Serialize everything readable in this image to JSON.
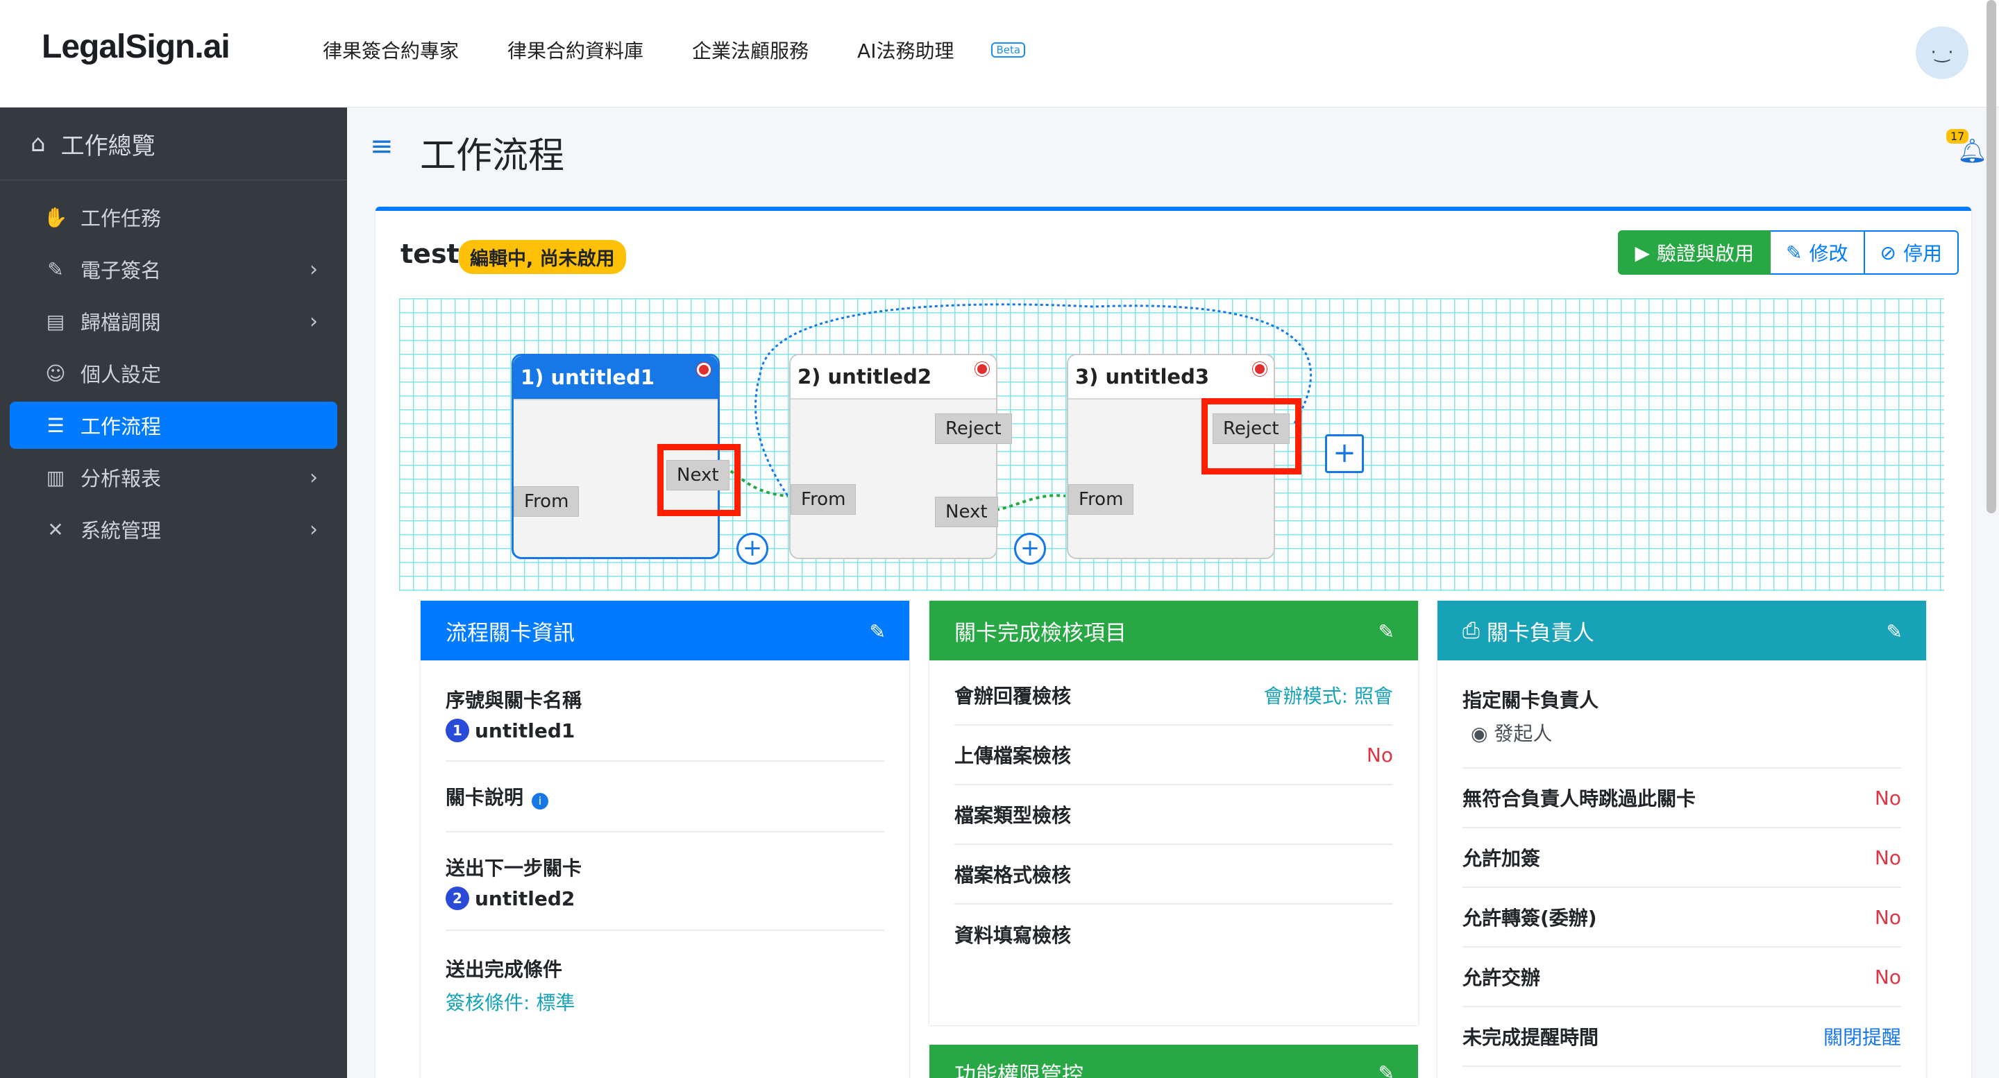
{
  "brand": "LegalSign.ai",
  "topnav": [
    "律果簽合約專家",
    "律果合約資料庫",
    "企業法顧服務",
    "AI法務助理"
  ],
  "topnav_beta": "Beta",
  "avatar_face": "· ͜ ·",
  "sidebar": {
    "head": "工作總覽",
    "items": [
      {
        "label": "工作任務",
        "icon": "handshake-icon"
      },
      {
        "label": "電子簽名",
        "icon": "signature-icon"
      },
      {
        "label": "歸檔調閱",
        "icon": "archive-icon"
      },
      {
        "label": "個人設定",
        "icon": "user-cog-icon"
      },
      {
        "label": "工作流程",
        "icon": "tasks-icon"
      },
      {
        "label": "分析報表",
        "icon": "chart-icon"
      },
      {
        "label": "系統管理",
        "icon": "tools-icon"
      }
    ]
  },
  "page_title": "工作流程",
  "notification_count": "17",
  "card": {
    "title": "test",
    "status": "編輯中, 尚未啟用",
    "buttons": {
      "validate": "驗證與啟用",
      "edit": "修改",
      "disable": "停用"
    }
  },
  "flow": {
    "nodes": [
      {
        "title": "1) untitled1",
        "from": "From",
        "next": "Next"
      },
      {
        "title": "2) untitled2",
        "from": "From",
        "reject": "Reject",
        "next": "Next"
      },
      {
        "title": "3) untitled3",
        "from": "From",
        "reject": "Reject"
      }
    ],
    "plus": "+"
  },
  "panel1": {
    "title": "流程關卡資訊",
    "seq_label": "序號與關卡名稱",
    "seq_num": "1",
    "seq_name": "untitled1",
    "desc_label": "關卡說明",
    "info_icon": "i",
    "next_label": "送出下一步關卡",
    "next_num": "2",
    "next_name": "untitled2",
    "cond_label": "送出完成條件",
    "cond_value": "簽核條件: 標準"
  },
  "panel2": {
    "title": "關卡完成檢核項目",
    "rows": [
      {
        "label": "會辦回覆檢核",
        "value": "會辦模式: 照會"
      },
      {
        "label": "上傳檔案檢核",
        "value": "No"
      },
      {
        "label": "檔案類型檢核",
        "value": ""
      },
      {
        "label": "檔案格式檢核",
        "value": ""
      },
      {
        "label": "資料填寫檢核",
        "value": ""
      }
    ],
    "next_panel_title": "功能權限管控"
  },
  "panel3": {
    "title": "關卡負責人",
    "assignee_label": "指定關卡負責人",
    "assignee_value": "發起人",
    "rows": [
      {
        "label": "無符合負責人時跳過此關卡",
        "value": "No"
      },
      {
        "label": "允許加簽",
        "value": "No"
      },
      {
        "label": "允許轉簽(委辦)",
        "value": "No"
      },
      {
        "label": "允許交辦",
        "value": "No"
      },
      {
        "label": "未完成提醒時間",
        "value": "關閉提醒"
      }
    ]
  },
  "colors": {
    "primary": "#007bff",
    "success": "#28a745",
    "info": "#17a2b8",
    "warning": "#ffc107",
    "danger": "#dc3545",
    "highlight": "#ff1e00"
  }
}
